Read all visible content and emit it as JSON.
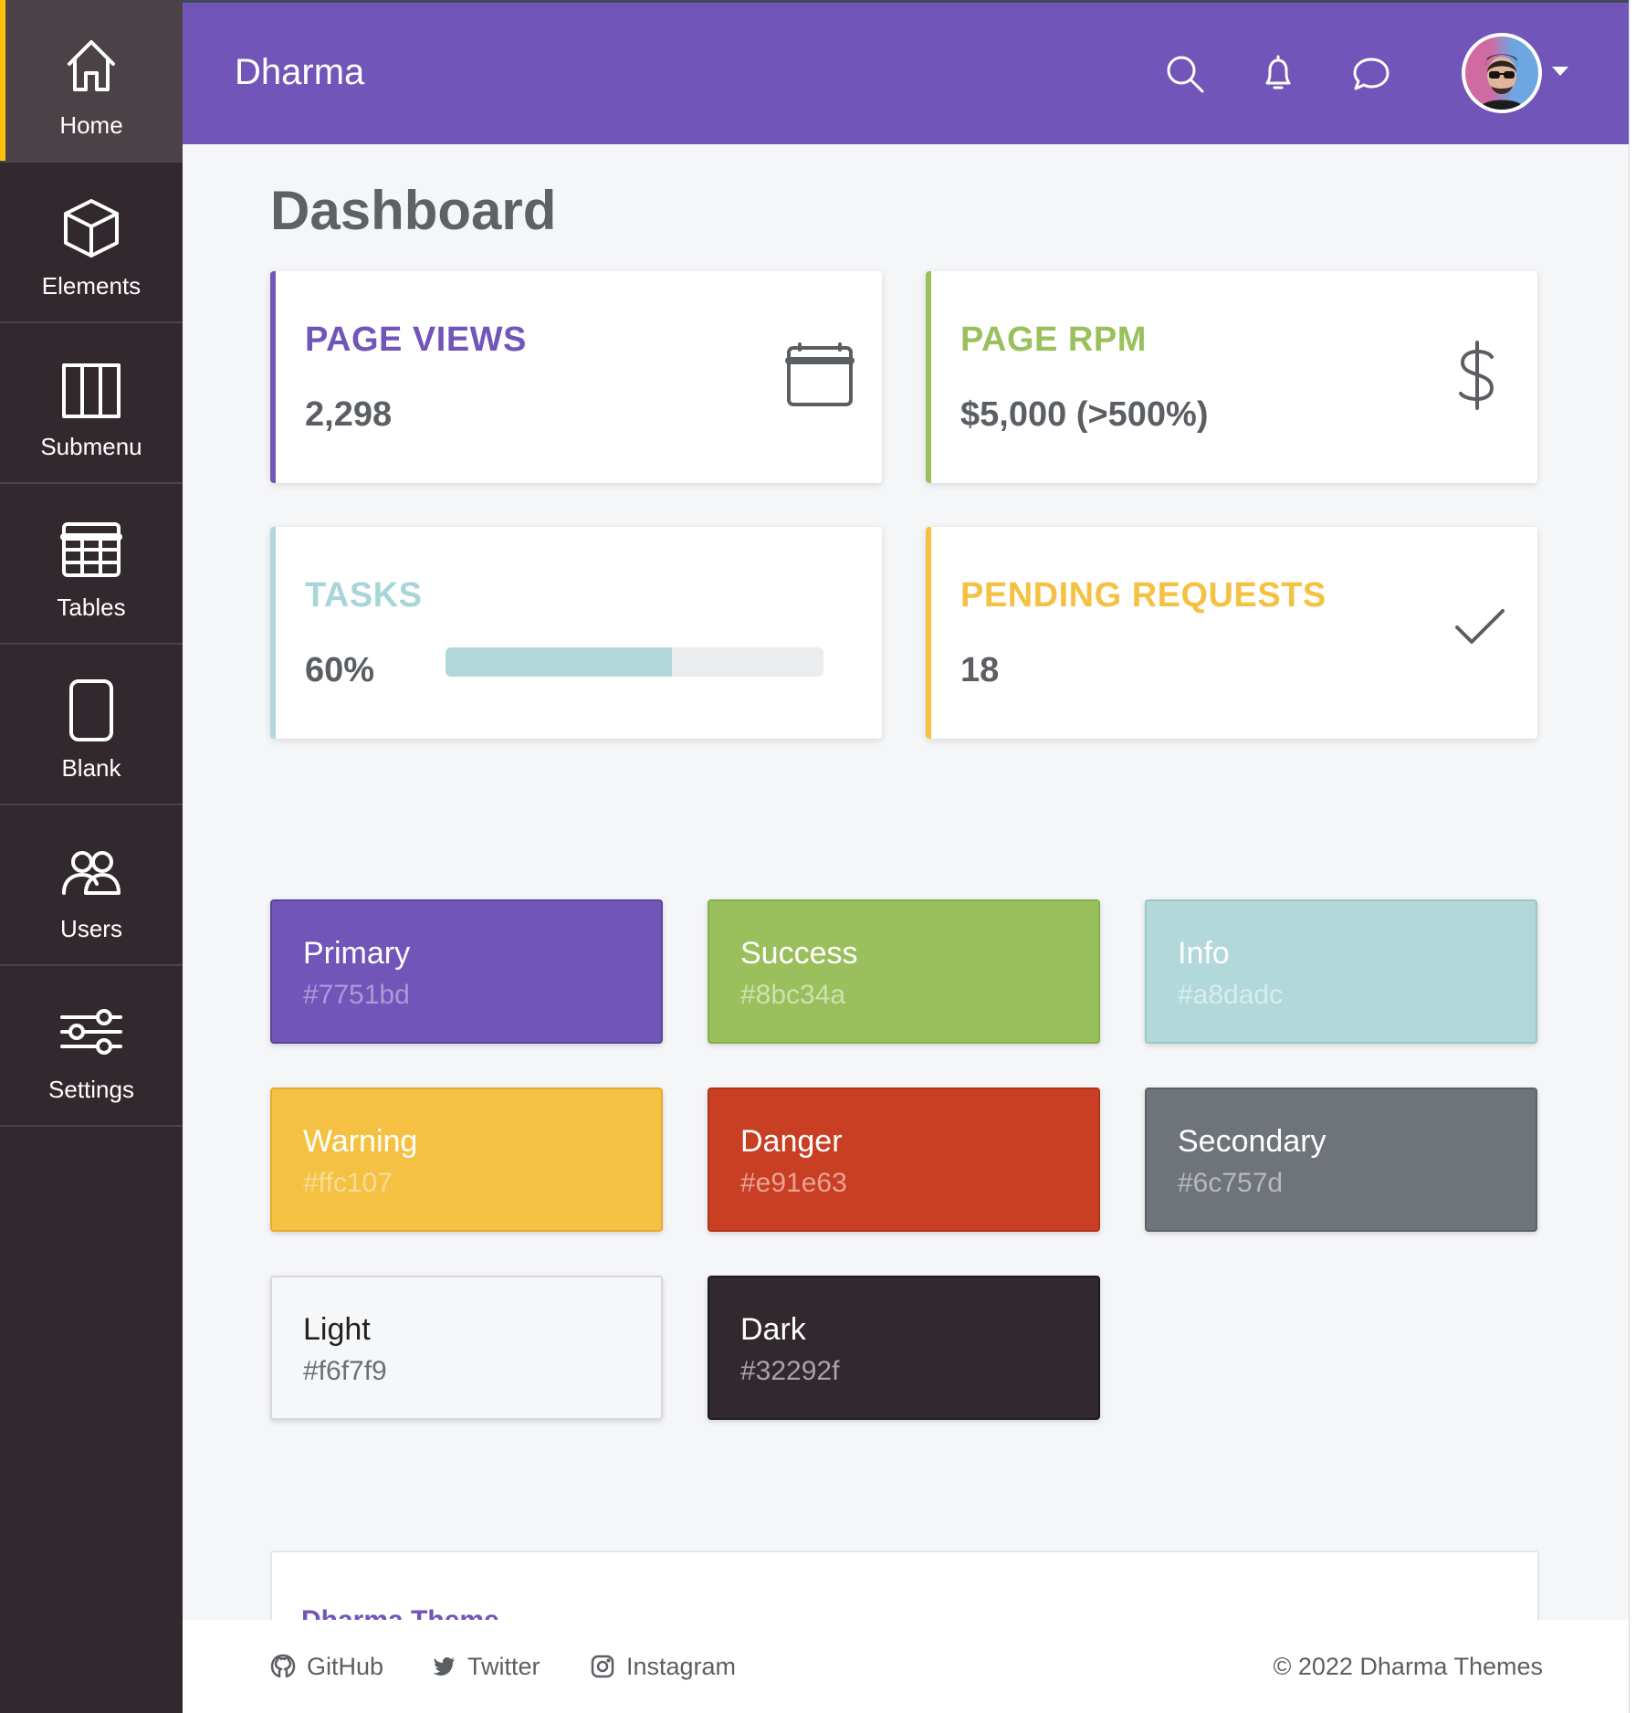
{
  "sidebar": {
    "items": [
      {
        "label": "Home",
        "icon": "home-icon",
        "active": true
      },
      {
        "label": "Elements",
        "icon": "cube-icon"
      },
      {
        "label": "Submenu",
        "icon": "map-icon"
      },
      {
        "label": "Tables",
        "icon": "table-icon"
      },
      {
        "label": "Blank",
        "icon": "tablet-icon"
      },
      {
        "label": "Users",
        "icon": "users-icon"
      },
      {
        "label": "Settings",
        "icon": "sliders-icon"
      }
    ]
  },
  "header": {
    "brand": "Dharma",
    "icons": [
      "search-icon",
      "bell-icon",
      "chat-icon"
    ],
    "avatar": "user-avatar"
  },
  "main": {
    "title": "Dashboard",
    "cards": [
      {
        "title": "PAGE VIEWS",
        "value": "2,298",
        "color": "#7751bd",
        "icon": "calendar-icon"
      },
      {
        "title": "PAGE RPM",
        "value": "$5,000 (>500%)",
        "color": "#8bc34a",
        "icon": "dollar-icon"
      },
      {
        "title": "TASKS",
        "value": "60%",
        "color": "#a8dadc",
        "progress": 0.6
      },
      {
        "title": "PENDING REQUESTS",
        "value": "18",
        "color": "#ffc107",
        "icon": "check-icon"
      }
    ],
    "swatches": [
      {
        "name": "Primary",
        "hex": "#7751bd",
        "bg": "#7155b8"
      },
      {
        "name": "Success",
        "hex": "#8bc34a",
        "bg": "#99c05d"
      },
      {
        "name": "Info",
        "hex": "#a8dadc",
        "bg": "#b2d8da"
      },
      {
        "name": "Warning",
        "hex": "#ffc107",
        "bg": "#f5c142"
      },
      {
        "name": "Danger",
        "hex": "#e91e63",
        "bg": "#c93f23"
      },
      {
        "name": "Secondary",
        "hex": "#6c757d",
        "bg": "#6f747b"
      },
      {
        "name": "Light",
        "hex": "#f6f7f9",
        "bg": "#f6f7f9"
      },
      {
        "name": "Dark",
        "hex": "#32292f",
        "bg": "#32292f"
      }
    ],
    "panel_title": "Dharma Theme"
  },
  "footer": {
    "links": [
      {
        "label": "GitHub",
        "icon": "github-icon"
      },
      {
        "label": "Twitter",
        "icon": "twitter-icon"
      },
      {
        "label": "Instagram",
        "icon": "instagram-icon"
      }
    ],
    "copyright": "© 2022 Dharma Themes"
  }
}
